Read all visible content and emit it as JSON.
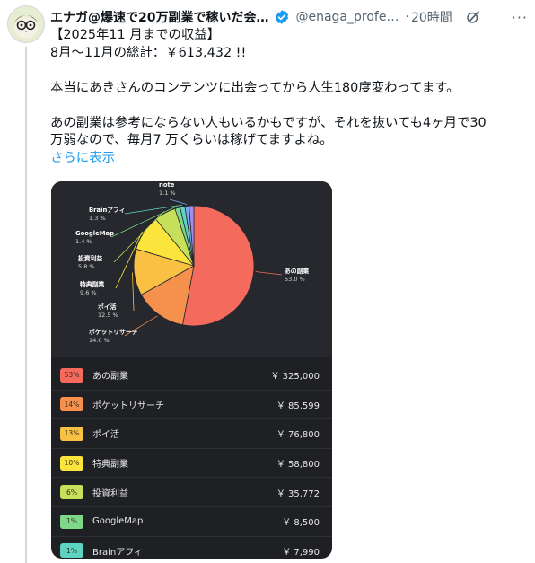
{
  "post": {
    "author_name": "エナガ@爆速で20万副業で稼いだ会…",
    "handle": "@enaga_profes…",
    "separator": "·",
    "time": "20時間",
    "lines": [
      "【2025年11 月までの収益】",
      "8月～11月の総計：￥613,432 !!",
      "",
      "本当にあきさんのコンテンツに出会ってから人生180度変わってます。",
      "",
      "あの副業は参考にならない人もいるかもですが、それを抜いても4ヶ月で30",
      "万弱なので、毎月7 万くらいは稼げてますよね。"
    ],
    "show_more": "さらに表示"
  },
  "icons": {
    "avatar": "avatar-image",
    "verified": "verified-badge-icon",
    "grok": "grok-icon",
    "more": "more-icon"
  },
  "colors": {
    "verified": "#1d9bf0",
    "link": "#1d9bf0",
    "card_bg": "#1f2024"
  },
  "chart_data": {
    "type": "pie",
    "slices": [
      {
        "label": "あの副業",
        "pct_label": "53.0 %",
        "value": 53.0,
        "color": "#f46b5d"
      },
      {
        "label": "ポケットリサーチ",
        "pct_label": "14.0 %",
        "value": 14.0,
        "color": "#f5904d"
      },
      {
        "label": "ポイ活",
        "pct_label": "12.5 %",
        "value": 12.5,
        "color": "#f9c144"
      },
      {
        "label": "特典副業",
        "pct_label": "9.6 %",
        "value": 9.6,
        "color": "#fbe43c"
      },
      {
        "label": "投資利益",
        "pct_label": "5.8 %",
        "value": 5.8,
        "color": "#c6e05a"
      },
      {
        "label": "GoogleMap",
        "pct_label": "1.4 %",
        "value": 1.4,
        "color": "#7fd88a"
      },
      {
        "label": "Brainアフィ",
        "pct_label": "1.3 %",
        "value": 1.3,
        "color": "#5fd3c1"
      },
      {
        "label": "note",
        "pct_label": "1.1 %",
        "value": 1.1,
        "color": "#7aa8f0"
      },
      {
        "label": "",
        "pct_label": "",
        "value": 1.3,
        "color": "#a58cf0"
      }
    ]
  },
  "table": {
    "rows": [
      {
        "pct": "53%",
        "name": "あの副業",
        "amount": "￥ 325,000",
        "color": "#f46b5d"
      },
      {
        "pct": "14%",
        "name": "ポケットリサーチ",
        "amount": "￥ 85,599",
        "color": "#f5904d"
      },
      {
        "pct": "13%",
        "name": "ポイ活",
        "amount": "￥ 76,800",
        "color": "#f9c144"
      },
      {
        "pct": "10%",
        "name": "特典副業",
        "amount": "￥ 58,800",
        "color": "#fbe43c"
      },
      {
        "pct": "6%",
        "name": "投資利益",
        "amount": "￥ 35,772",
        "color": "#c6e05a"
      },
      {
        "pct": "1%",
        "name": "GoogleMap",
        "amount": "￥ 8,500",
        "color": "#7fd88a"
      },
      {
        "pct": "1%",
        "name": "Brainアフィ",
        "amount": "￥ 7,990",
        "color": "#5fd3c1"
      }
    ]
  }
}
